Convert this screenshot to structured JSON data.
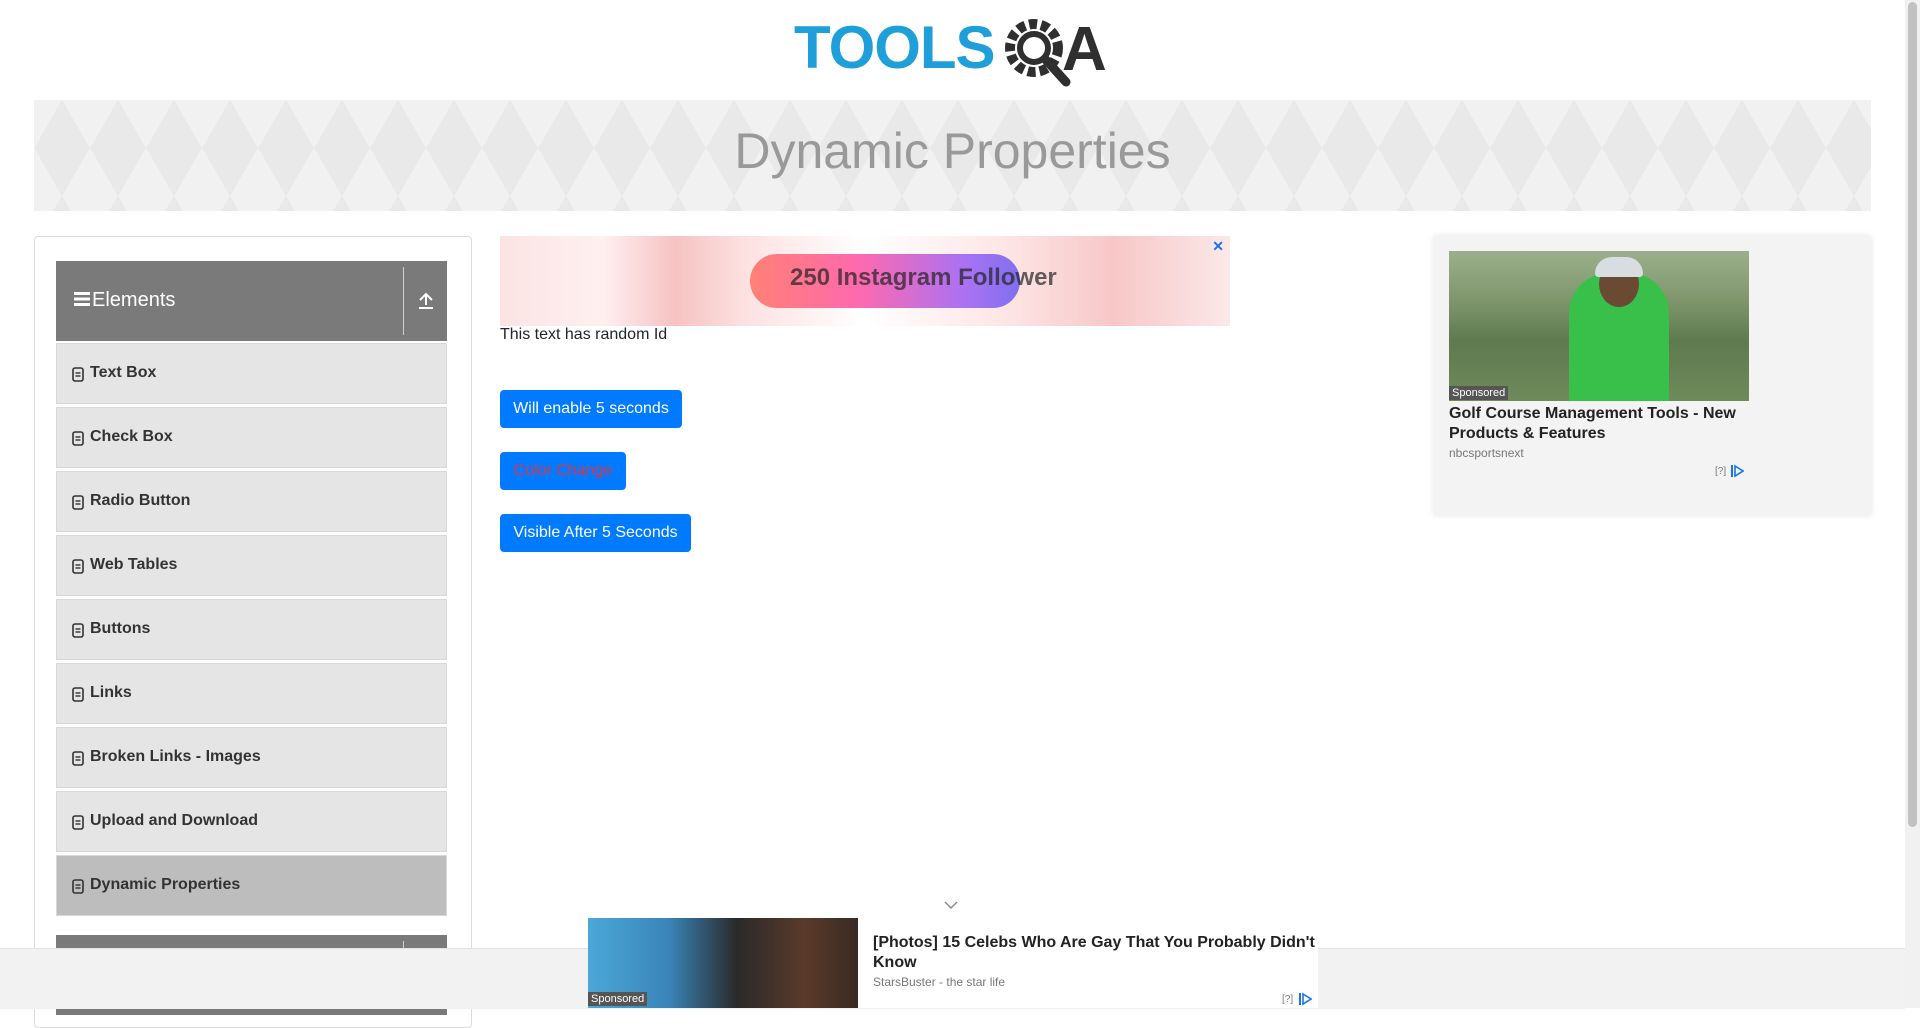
{
  "header": {
    "logo_text": "TOOLS",
    "logo_letter": "A",
    "page_title": "Dynamic Properties"
  },
  "sidebar": {
    "group": "Elements",
    "items": [
      {
        "label": "Text Box"
      },
      {
        "label": "Check Box"
      },
      {
        "label": "Radio Button"
      },
      {
        "label": "Web Tables"
      },
      {
        "label": "Buttons"
      },
      {
        "label": "Links"
      },
      {
        "label": "Broken Links - Images"
      },
      {
        "label": "Upload and Download"
      },
      {
        "label": "Dynamic Properties"
      }
    ],
    "active_item": "Dynamic Properties"
  },
  "main": {
    "top_ad": {
      "text": "250 Instagram Follower"
    },
    "random_text": "This text has random Id",
    "buttons": {
      "enable_after": "Will enable 5 seconds",
      "color_change": "Color Change",
      "visible_after": "Visible After 5 Seconds"
    }
  },
  "right_ad": {
    "sponsored": "Sponsored",
    "title": "Golf Course Management Tools - New Products & Features",
    "source": "nbcsportsnext",
    "help": "[?]"
  },
  "bottom_ad": {
    "sponsored": "Sponsored",
    "title": "[Photos] 15 Celebs Who Are Gay That You Probably Didn't Know",
    "source": "StarsBuster - the star life",
    "help": "[?]"
  },
  "colors": {
    "primary_button": "#007bff",
    "color_change_text": "#dc3545",
    "logo_blue": "#1e9fda",
    "sidebar_header": "#7a7a7a"
  }
}
